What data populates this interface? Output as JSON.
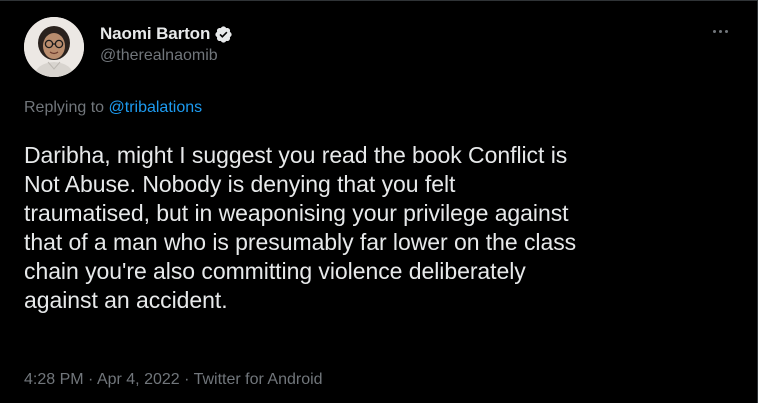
{
  "author": {
    "display_name": "Naomi Barton",
    "handle": "@therealnaomib",
    "verified": true
  },
  "reply": {
    "prefix": "Replying to ",
    "mention": "@tribalations"
  },
  "tweet": {
    "text": "Daribha, might I suggest you read the book Conflict is\nNot Abuse. Nobody is denying that you felt\ntraumatised, but in weaponising your privilege against\nthat of a man who is presumably far lower on the class\nchain you're also committing violence deliberately\nagainst an accident."
  },
  "meta": {
    "time": "4:28 PM",
    "separator1": " · ",
    "date": "Apr 4, 2022",
    "separator2": " · ",
    "source": "Twitter for Android"
  },
  "colors": {
    "background": "#000000",
    "text": "#e7e9ea",
    "muted": "#71767b",
    "accent": "#1d9bf0"
  },
  "icons": {
    "more": "more-icon",
    "verified": "verified-badge-icon"
  }
}
